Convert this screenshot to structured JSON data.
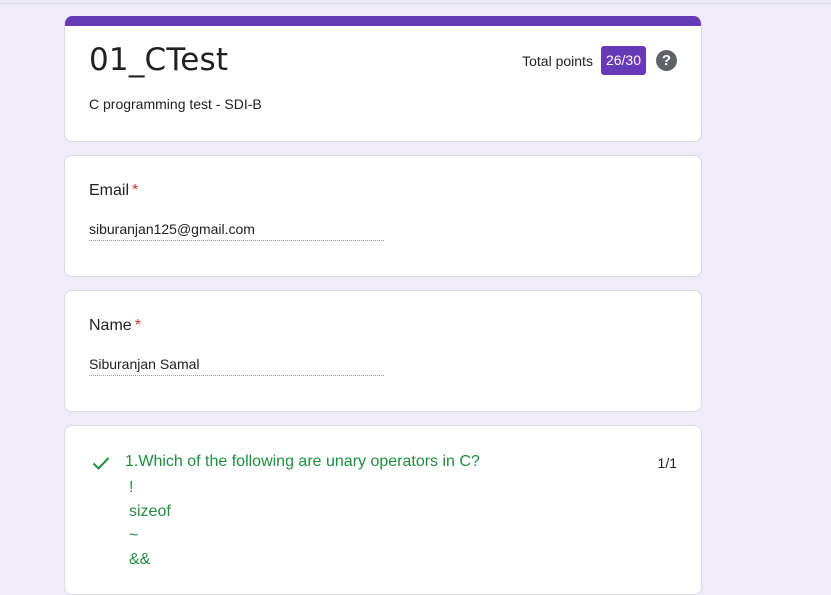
{
  "header": {
    "title": "01_CTest",
    "description": "C programming test - SDI-B",
    "points_label": "Total points",
    "points_value": "26/30",
    "help_icon": "help-circle-icon",
    "accent_color": "#673ab7"
  },
  "email": {
    "label": "Email",
    "required_mark": "*",
    "value": "siburanjan125@gmail.com"
  },
  "name": {
    "label": "Name",
    "required_mark": "*",
    "value": "Siburanjan Samal"
  },
  "question1": {
    "icon": "checkmark-icon",
    "text": "1.Which of the following are unary operators in C?",
    "score": "1/1",
    "correct_color": "#1e8e3e",
    "options": [
      "!",
      "sizeof",
      "~",
      "&&"
    ]
  }
}
